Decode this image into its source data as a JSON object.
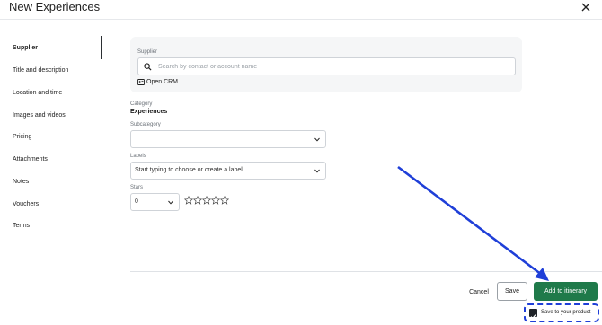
{
  "header": {
    "title": "New Experiences"
  },
  "sidebar": {
    "items": [
      {
        "label": "Supplier",
        "active": true
      },
      {
        "label": "Title and description"
      },
      {
        "label": "Location and time"
      },
      {
        "label": "Images and videos"
      },
      {
        "label": "Pricing"
      },
      {
        "label": "Attachments"
      },
      {
        "label": "Notes"
      },
      {
        "label": "Vouchers"
      },
      {
        "label": "Terms"
      }
    ]
  },
  "supplier": {
    "label": "Supplier",
    "search_placeholder": "Search by contact or account name",
    "open_crm_label": "Open CRM"
  },
  "category": {
    "label": "Category",
    "value": "Experiences"
  },
  "subcategory": {
    "label": "Subcategory",
    "value": ""
  },
  "labels": {
    "label": "Labels",
    "placeholder": "Start typing to choose or create a label"
  },
  "stars": {
    "label": "Stars",
    "value": "0",
    "rating_out_of": 5
  },
  "footer": {
    "cancel_label": "Cancel",
    "save_label": "Save",
    "add_label": "Add to itinerary",
    "save_product_label": "Save to your product",
    "save_product_checked": true
  },
  "colors": {
    "primary": "#1f7a4a",
    "annotation": "#1f3fd8"
  }
}
